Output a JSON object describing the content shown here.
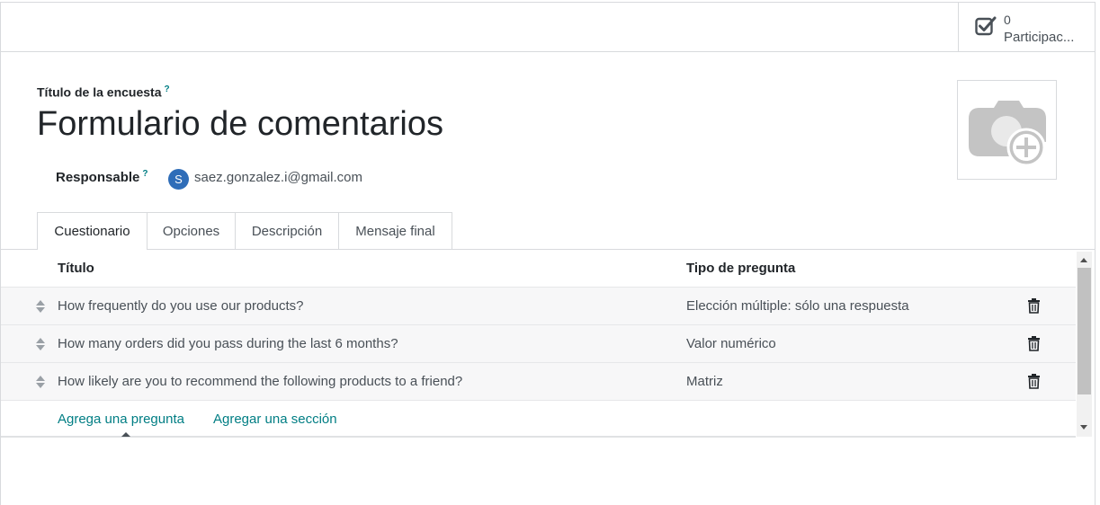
{
  "stat_button": {
    "value": "0",
    "label": "Participac...",
    "icon": "checkbox-check-icon"
  },
  "form": {
    "title_label": "Título de la encuesta",
    "title_help": "?",
    "title_value": "Formulario de comentarios",
    "responsible_label": "Responsable",
    "responsible_help": "?",
    "responsible_avatar_letter": "S",
    "responsible_value": "saez.gonzalez.i@gmail.com",
    "avatar_color": "#2f6db8",
    "image_placeholder_icon": "camera-add-icon"
  },
  "tabs": [
    {
      "label": "Cuestionario",
      "active": true
    },
    {
      "label": "Opciones",
      "active": false
    },
    {
      "label": "Descripción",
      "active": false
    },
    {
      "label": "Mensaje final",
      "active": false
    }
  ],
  "list": {
    "headers": {
      "title": "Título",
      "type": "Tipo de pregunta"
    },
    "rows": [
      {
        "title": "How frequently do you use our products?",
        "type": "Elección múltiple: sólo una respuesta"
      },
      {
        "title": "How many orders did you pass during the last 6 months?",
        "type": "Valor numérico"
      },
      {
        "title": "How likely are you to recommend the following products to a friend?",
        "type": "Matriz"
      }
    ],
    "add_question": "Agrega una pregunta",
    "add_section": "Agregar una sección"
  },
  "colors": {
    "link": "#017e84",
    "border": "#d8dadd"
  }
}
